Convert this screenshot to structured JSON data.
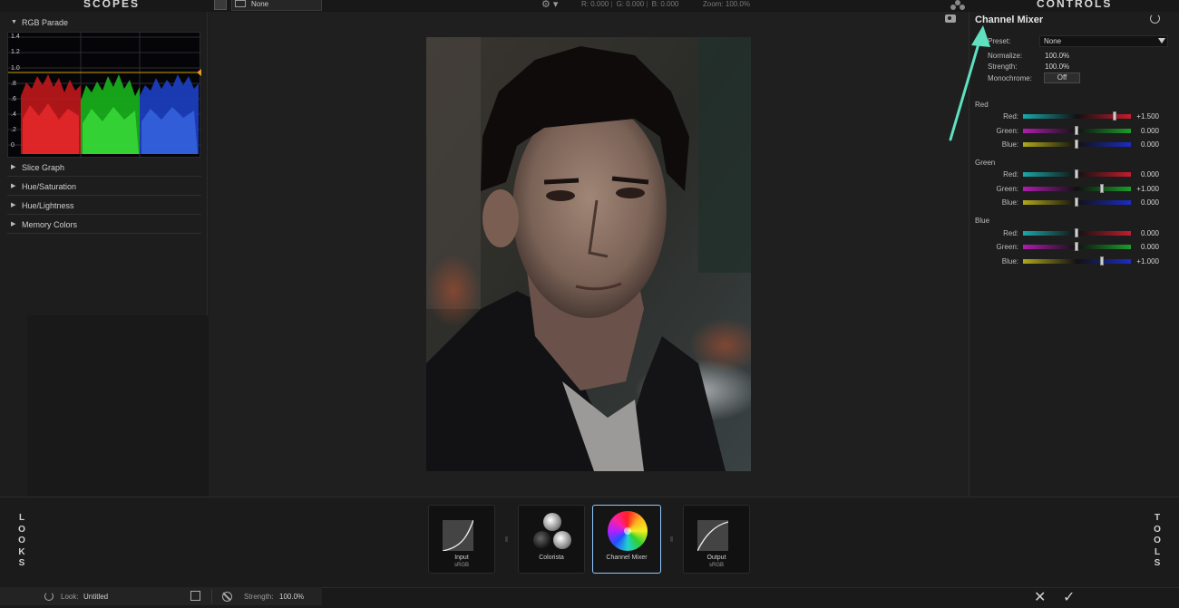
{
  "header": {
    "scopes_title": "SCOPES",
    "controls_title": "CONTROLS",
    "preset_select": "None",
    "readout": {
      "r": "R: 0.000",
      "g": "G: 0.000",
      "b": "B: 0.000"
    },
    "zoom": "Zoom: 100.0%"
  },
  "scopes": {
    "rgb_parade_label": "RGB Parade",
    "axis_ticks": [
      "1.4",
      "1.2",
      "1.0",
      ".8",
      ".6",
      ".4",
      ".2",
      "0"
    ],
    "sections": [
      "Slice Graph",
      "Hue/Saturation",
      "Hue/Lightness",
      "Memory Colors"
    ]
  },
  "controls": {
    "title": "Channel Mixer",
    "preset_label": "Preset:",
    "preset_value": "None",
    "normalize_label": "Normalize:",
    "normalize_value": "100.0%",
    "strength_label": "Strength:",
    "strength_value": "100.0%",
    "monochrome_label": "Monochrome:",
    "monochrome_value": "Off",
    "groups": [
      {
        "name": "Red",
        "sliders": [
          {
            "label": "Red:",
            "value": "+1.500",
            "fraction": 0.85
          },
          {
            "label": "Green:",
            "value": "0.000",
            "fraction": 0.5
          },
          {
            "label": "Blue:",
            "value": "0.000",
            "fraction": 0.5
          }
        ]
      },
      {
        "name": "Green",
        "sliders": [
          {
            "label": "Red:",
            "value": "0.000",
            "fraction": 0.5
          },
          {
            "label": "Green:",
            "value": "+1.000",
            "fraction": 0.73
          },
          {
            "label": "Blue:",
            "value": "0.000",
            "fraction": 0.5
          }
        ]
      },
      {
        "name": "Blue",
        "sliders": [
          {
            "label": "Red:",
            "value": "0.000",
            "fraction": 0.5
          },
          {
            "label": "Green:",
            "value": "0.000",
            "fraction": 0.5
          },
          {
            "label": "Blue:",
            "value": "+1.000",
            "fraction": 0.73
          }
        ]
      }
    ]
  },
  "tray": {
    "looks_label": "LOOKS",
    "tools_label": "TOOLS",
    "tools": [
      {
        "name": "Input",
        "sub": "sRGB"
      },
      {
        "name": "Colorista",
        "sub": ""
      },
      {
        "name": "Channel Mixer",
        "sub": ""
      },
      {
        "name": "Output",
        "sub": "sRGB"
      }
    ]
  },
  "status": {
    "look_label": "Look:",
    "look_value": "Untitled",
    "strength_label": "Strength:",
    "strength_value": "100.0%"
  },
  "colors": {
    "accent": "#8fc9ff",
    "annotation_arrow": "#5fe0c0",
    "track_cyan_red": [
      "#1aa8a8",
      "#c41c2c"
    ],
    "track_magenta_green": [
      "#b01cb0",
      "#1c9c2c"
    ],
    "track_yellow_blue": [
      "#b0a81a",
      "#1c2cc4"
    ]
  }
}
